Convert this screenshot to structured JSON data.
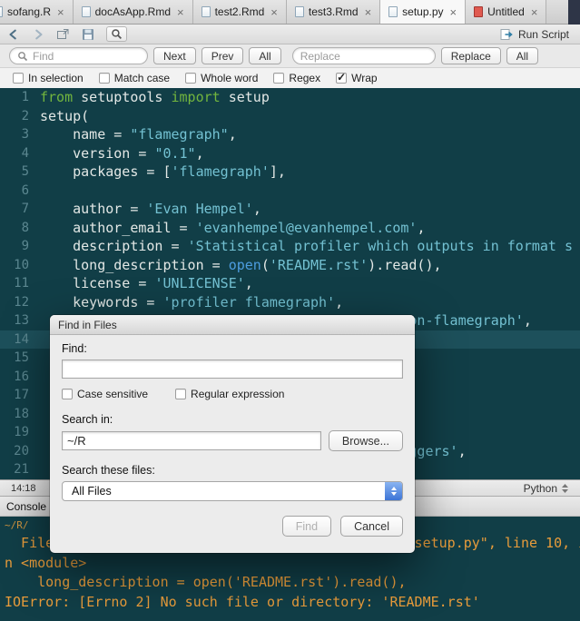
{
  "tab_bar": {
    "close_glyph": "×",
    "tabs": [
      {
        "label": "sofang.R",
        "active": false,
        "untitled": false
      },
      {
        "label": "docAsApp.Rmd",
        "active": false,
        "untitled": false
      },
      {
        "label": "test2.Rmd",
        "active": false,
        "untitled": false
      },
      {
        "label": "test3.Rmd",
        "active": false,
        "untitled": false
      },
      {
        "label": "setup.py",
        "active": true,
        "untitled": false
      },
      {
        "label": "Untitled",
        "active": false,
        "untitled": true
      }
    ]
  },
  "toolbar": {
    "run_script_label": "Run Script"
  },
  "find_bar": {
    "find_placeholder": "Find",
    "next_label": "Next",
    "prev_label": "Prev",
    "all_label": "All",
    "replace_placeholder": "Replace",
    "replace_label": "Replace",
    "replace_all_label": "All",
    "options": [
      {
        "label": "In selection",
        "checked": false
      },
      {
        "label": "Match case",
        "checked": false
      },
      {
        "label": "Whole word",
        "checked": false
      },
      {
        "label": "Regex",
        "checked": false
      },
      {
        "label": "Wrap",
        "checked": true
      }
    ]
  },
  "editor": {
    "current_line": 14,
    "lines": [
      {
        "n": 1,
        "seg": [
          [
            "k",
            "from"
          ],
          [
            "p",
            " setuptools "
          ],
          [
            "k",
            "import"
          ],
          [
            "p",
            " setup"
          ]
        ]
      },
      {
        "n": 2,
        "seg": [
          [
            "p",
            "setup("
          ]
        ]
      },
      {
        "n": 3,
        "seg": [
          [
            "p",
            "    name = "
          ],
          [
            "s",
            "\"flamegraph\""
          ],
          [
            "p",
            ","
          ]
        ]
      },
      {
        "n": 4,
        "seg": [
          [
            "p",
            "    version = "
          ],
          [
            "s",
            "\"0.1\""
          ],
          [
            "p",
            ","
          ]
        ]
      },
      {
        "n": 5,
        "seg": [
          [
            "p",
            "    packages = ["
          ],
          [
            "s",
            "'flamegraph'"
          ],
          [
            "p",
            "],"
          ]
        ]
      },
      {
        "n": 6,
        "seg": []
      },
      {
        "n": 7,
        "seg": [
          [
            "p",
            "    author = "
          ],
          [
            "s",
            "'Evan Hempel'"
          ],
          [
            "p",
            ","
          ]
        ]
      },
      {
        "n": 8,
        "seg": [
          [
            "p",
            "    author_email = "
          ],
          [
            "s",
            "'evanhempel@evanhempel.com'"
          ],
          [
            "p",
            ","
          ]
        ]
      },
      {
        "n": 9,
        "seg": [
          [
            "p",
            "    description = "
          ],
          [
            "s",
            "'Statistical profiler which outputs in format s"
          ]
        ]
      },
      {
        "n": 10,
        "seg": [
          [
            "p",
            "    long_description = "
          ],
          [
            "f",
            "open"
          ],
          [
            "p",
            "("
          ],
          [
            "s",
            "'README.rst'"
          ],
          [
            "p",
            ").read(),"
          ]
        ]
      },
      {
        "n": 11,
        "seg": [
          [
            "p",
            "    license = "
          ],
          [
            "s",
            "'UNLICENSE'"
          ],
          [
            "p",
            ","
          ]
        ]
      },
      {
        "n": 12,
        "seg": [
          [
            "p",
            "    keywords = "
          ],
          [
            "s",
            "'profiler flamegraph'"
          ],
          [
            "p",
            ","
          ]
        ]
      },
      {
        "n": 13,
        "seg": [
          [
            "pad",
            "45"
          ],
          [
            "s",
            "on-flamegraph'"
          ],
          [
            "p",
            ","
          ]
        ]
      },
      {
        "n": 14,
        "seg": []
      },
      {
        "n": 15,
        "seg": []
      },
      {
        "n": 16,
        "seg": []
      },
      {
        "n": 17,
        "seg": []
      },
      {
        "n": 18,
        "seg": []
      },
      {
        "n": 19,
        "seg": []
      },
      {
        "n": 20,
        "seg": [
          [
            "pad",
            "45"
          ],
          [
            "s",
            "ggers'"
          ],
          [
            "p",
            ","
          ]
        ]
      },
      {
        "n": 21,
        "seg": []
      }
    ]
  },
  "status_bar": {
    "cursor_position": "14:18",
    "language": "Python"
  },
  "console": {
    "tab_label": "Console",
    "working_directory": "~/R/",
    "lines": [
      [
        [
          "t",
          "  File \""
        ],
        [
          "pad",
          "42"
        ],
        [
          "t",
          "setup.py\", line 10, i"
        ]
      ],
      [
        [
          "t",
          "n <module>"
        ]
      ],
      [
        [
          "t",
          "    long_description = open('README.rst').read(),"
        ]
      ],
      [
        [
          "t",
          "IOError: [Errno 2] No such file or directory: 'README.rst'"
        ]
      ]
    ]
  },
  "dialog": {
    "title": "Find in Files",
    "find_label": "Find:",
    "find_value": "",
    "case_sensitive_label": "Case sensitive",
    "case_sensitive_checked": false,
    "regex_label": "Regular expression",
    "regex_checked": false,
    "search_in_label": "Search in:",
    "search_in_value": "~/R",
    "browse_label": "Browse...",
    "files_label": "Search these files:",
    "files_value": "All Files",
    "find_button_label": "Find",
    "cancel_button_label": "Cancel"
  },
  "colors": {
    "editor_background": "#113e47",
    "current_line_highlight": "#1d505b",
    "keyword_green": "#72b53e",
    "string_cyan": "#73c1d2",
    "function_blue": "#4d9de0",
    "line_number": "#5b8790",
    "console_text_orange": "#e89c3b",
    "dropdown_accent_blue": "#3c74d6"
  }
}
